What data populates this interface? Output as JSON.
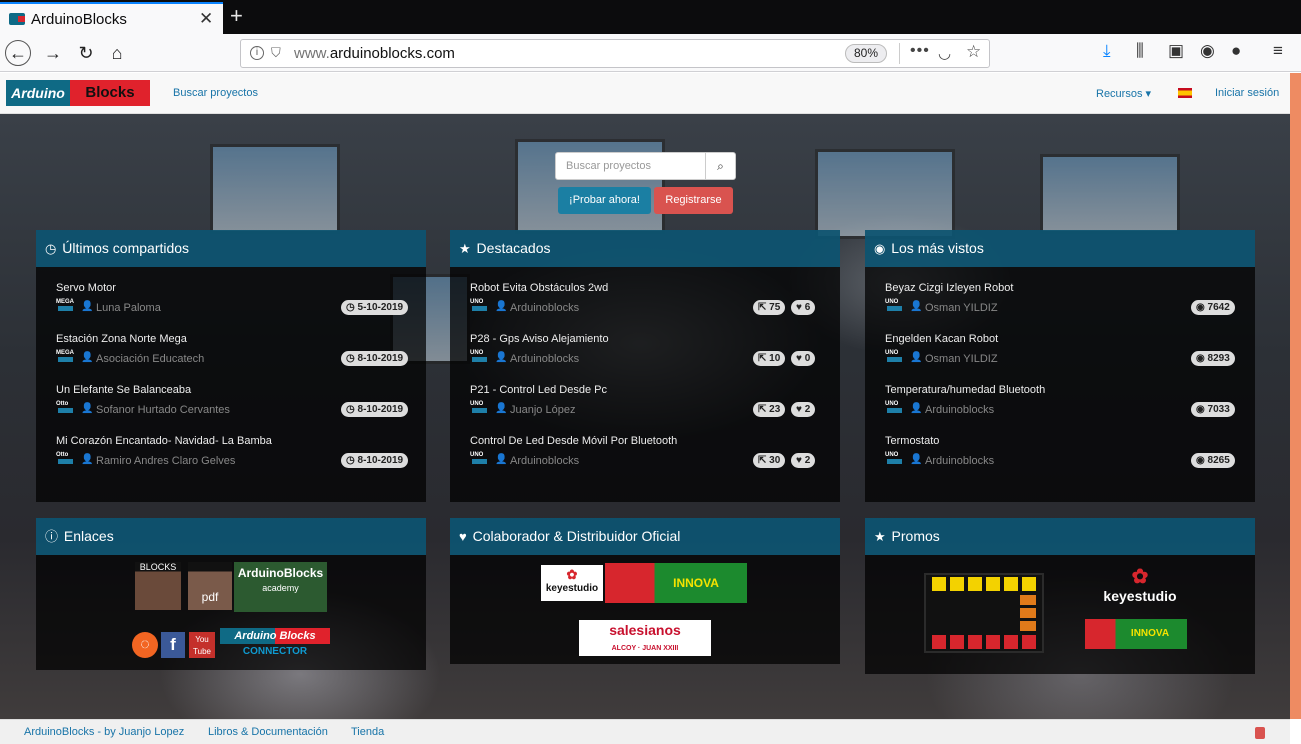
{
  "browser": {
    "tab_title": "ArduinoBlocks",
    "url_host": "www.arduinoblocks.com",
    "url_prefix": "www.",
    "url_domain": "arduinoblocks.com",
    "zoom": "80%"
  },
  "nav": {
    "logo_left": "Arduino",
    "logo_right": "Blocks",
    "search_projects": "Buscar proyectos",
    "resources": "Recursos ▾",
    "login": "Iniciar sesión"
  },
  "hero": {
    "search_placeholder": "Buscar proyectos",
    "try_now": "¡Probar ahora!",
    "register": "Registrarse"
  },
  "panels": {
    "latest": {
      "title": "Últimos compartidos",
      "items": [
        {
          "title": "Servo Motor",
          "board": "MEGA",
          "user": "Luna Paloma",
          "date": "5-10-2019"
        },
        {
          "title": "Estación Zona Norte Mega",
          "board": "MEGA",
          "user": "Asociación Educatech",
          "date": "8-10-2019"
        },
        {
          "title": "Un Elefante Se Balanceaba",
          "board": "Otto",
          "user": "Sofanor Hurtado Cervantes",
          "date": "8-10-2019"
        },
        {
          "title": "Mi Corazón Encantado- Navidad- La Bamba",
          "board": "Otto",
          "user": "Ramiro Andres Claro Gelves",
          "date": "8-10-2019"
        }
      ]
    },
    "featured": {
      "title": "Destacados",
      "items": [
        {
          "title": "Robot Evita Obstáculos 2wd",
          "board": "UNO",
          "user": "Arduinoblocks",
          "shares": "75",
          "likes": "6"
        },
        {
          "title": "P28 - Gps Aviso Alejamiento",
          "board": "UNO",
          "user": "Arduinoblocks",
          "shares": "10",
          "likes": "0"
        },
        {
          "title": "P21 - Control Led Desde Pc",
          "board": "UNO",
          "user": "Juanjo López",
          "shares": "23",
          "likes": "2"
        },
        {
          "title": "Control De Led Desde Móvil Por Bluetooth",
          "board": "UNO",
          "user": "Arduinoblocks",
          "shares": "30",
          "likes": "2"
        }
      ]
    },
    "mostviewed": {
      "title": "Los más vistos",
      "items": [
        {
          "title": "Beyaz Cizgi Izleyen Robot",
          "board": "UNO",
          "user": "Osman YILDIZ",
          "views": "7642"
        },
        {
          "title": "Engelden Kacan Robot",
          "board": "UNO",
          "user": "Osman YILDIZ",
          "views": "8293"
        },
        {
          "title": "Temperatura/humedad Bluetooth",
          "board": "UNO",
          "user": "Arduinoblocks",
          "views": "7033"
        },
        {
          "title": "Termostato",
          "board": "UNO",
          "user": "Arduinoblocks",
          "views": "8265"
        }
      ]
    },
    "links": {
      "title": "Enlaces",
      "book1": "BLOCKS",
      "book2": "pdf",
      "academy": "ArduinoBlocks",
      "academy_sub": "academy",
      "connector_top": "Arduino Blocks",
      "connector_bottom": "CONNECTOR",
      "youtube": "You Tube"
    },
    "partner": {
      "title": "Colaborador & Distribuidor Oficial",
      "keyestudio": "keyestudio",
      "innova": "INNOVA DIDACTIC",
      "salesianos": "salesianos",
      "salesianos_sub": "ALCOY · JUAN XXIII"
    },
    "promos": {
      "title": "Promos",
      "keyestudio": "keyestudio",
      "innova": "INNOVA DIDACTIC"
    }
  },
  "footer": {
    "brand": "ArduinoBlocks - by Juanjo Lopez",
    "docs": "Libros & Documentación",
    "shop": "Tienda"
  }
}
